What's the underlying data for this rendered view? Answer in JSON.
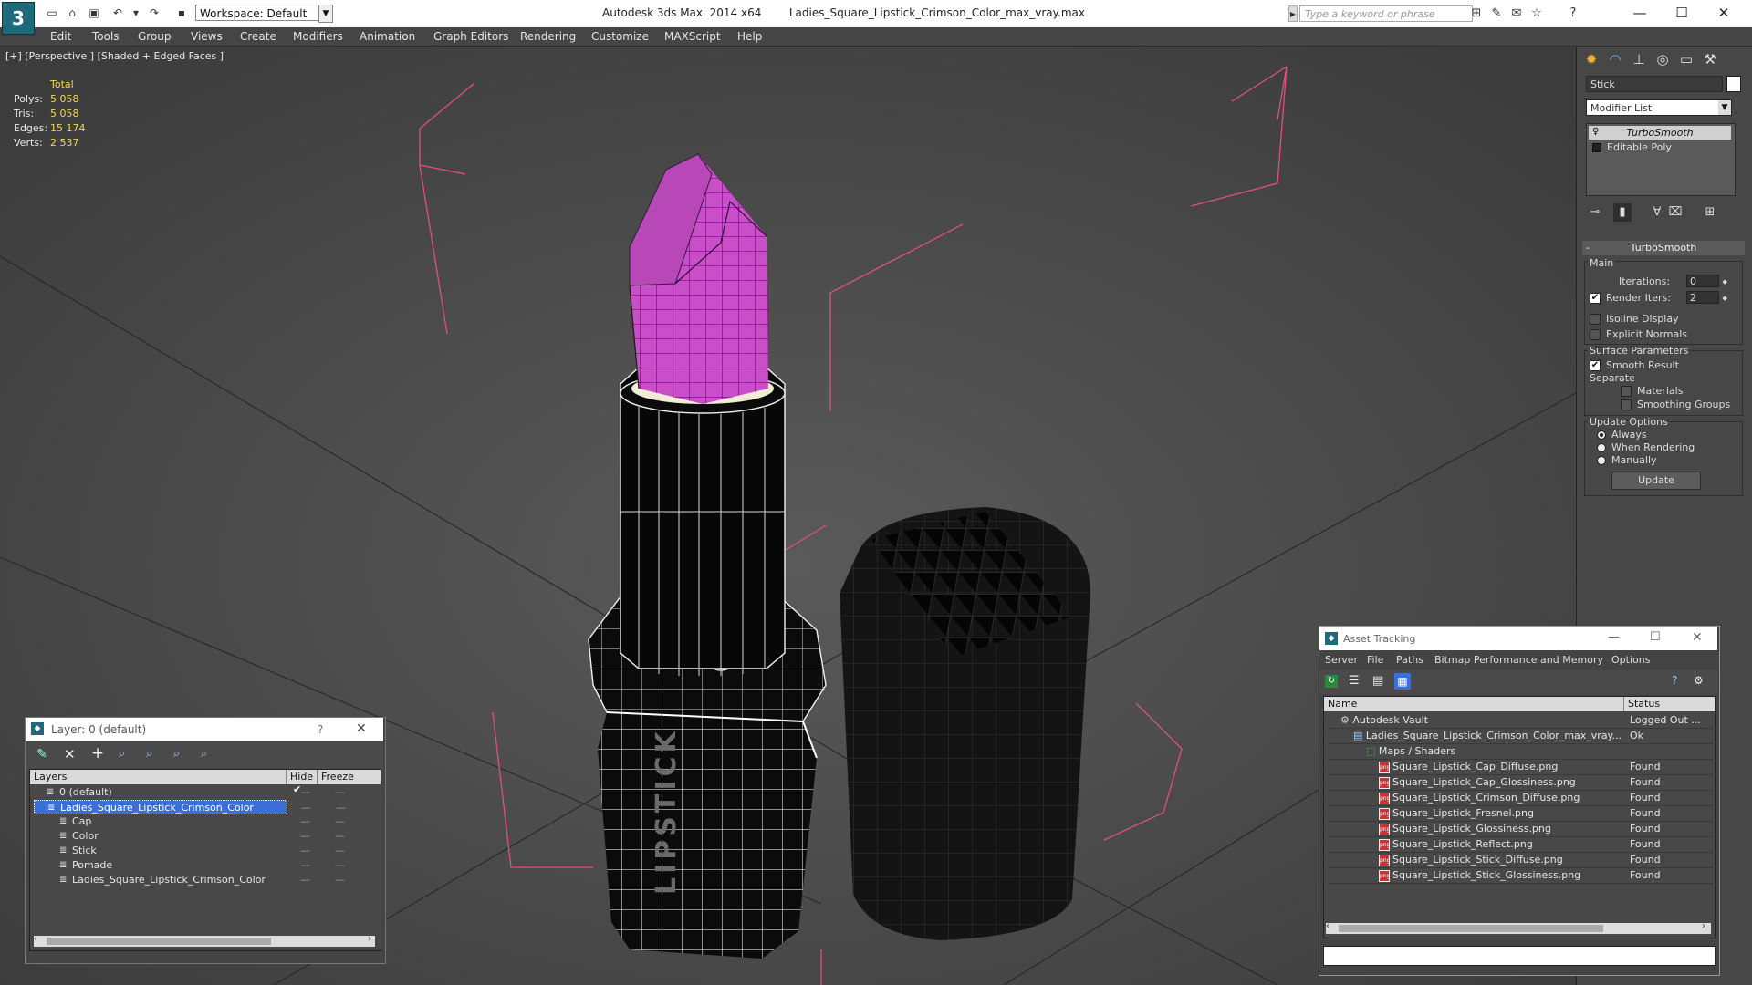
{
  "title_bar": {
    "app": "Autodesk 3ds Max  2014 x64",
    "file": "Ladies_Square_Lipstick_Crimson_Color_max_vray.max",
    "workspace": "Workspace: Default",
    "search_placeholder": "Type a keyword or phrase",
    "logo": "3"
  },
  "menu": [
    "Edit",
    "Tools",
    "Group",
    "Views",
    "Create",
    "Modifiers",
    "Animation",
    "Graph Editors",
    "Rendering",
    "Customize",
    "MAXScript",
    "Help"
  ],
  "viewport": {
    "label": "[+] [Perspective ] [Shaded + Edged Faces ]",
    "stats_header": "Total",
    "stats": [
      {
        "label": "Polys:",
        "value": "5 058"
      },
      {
        "label": "Tris:",
        "value": "5 058"
      },
      {
        "label": "Edges:",
        "value": "15 174"
      },
      {
        "label": "Verts:",
        "value": "2 537"
      }
    ],
    "engraving": "LIPSTICK"
  },
  "command_panel": {
    "object_name": "Stick",
    "modifier_list": "Modifier List",
    "stack": [
      "TurboSmooth",
      "Editable Poly"
    ],
    "rollout_title": "TurboSmooth",
    "main_label": "Main",
    "iterations_label": "Iterations:",
    "iterations_value": "0",
    "render_iters_label": "Render Iters:",
    "render_iters_value": "2",
    "isoline": "Isoline Display",
    "explicit": "Explicit Normals",
    "surface_label": "Surface Parameters",
    "smooth_result": "Smooth Result",
    "separate": "Separate",
    "materials": "Materials",
    "smoothing_groups": "Smoothing Groups",
    "update_options": "Update Options",
    "always": "Always",
    "when_rendering": "When Rendering",
    "manually": "Manually",
    "update_button": "Update"
  },
  "layer_dialog": {
    "title": "Layer: 0 (default)",
    "help": "?",
    "columns": [
      "Layers",
      "Hide",
      "Freeze"
    ],
    "rows": [
      {
        "name": "0 (default)",
        "indent": 1
      },
      {
        "name": "Ladies_Square_Lipstick_Crimson_Color",
        "indent": 1,
        "selected": true
      },
      {
        "name": "Cap",
        "indent": 2
      },
      {
        "name": "Color",
        "indent": 2
      },
      {
        "name": "Stick",
        "indent": 2
      },
      {
        "name": "Pomade",
        "indent": 2
      },
      {
        "name": "Ladies_Square_Lipstick_Crimson_Color",
        "indent": 2
      }
    ]
  },
  "asset_dialog": {
    "title": "Asset Tracking",
    "menu": [
      "Server",
      "File",
      "Paths",
      "Bitmap Performance and Memory",
      "Options"
    ],
    "columns": [
      "Name",
      "Status"
    ],
    "rows": [
      {
        "name": "Autodesk Vault",
        "status": "Logged Out ...",
        "indent": 1
      },
      {
        "name": "Ladies_Square_Lipstick_Crimson_Color_max_vray....",
        "status": "Ok",
        "indent": 2
      },
      {
        "name": "Maps / Shaders",
        "status": "",
        "indent": 3
      },
      {
        "name": "Square_Lipstick_Cap_Diffuse.png",
        "status": "Found",
        "indent": 4
      },
      {
        "name": "Square_Lipstick_Cap_Glossiness.png",
        "status": "Found",
        "indent": 4
      },
      {
        "name": "Square_Lipstick_Crimson_Diffuse.png",
        "status": "Found",
        "indent": 4
      },
      {
        "name": "Square_Lipstick_Fresnel.png",
        "status": "Found",
        "indent": 4
      },
      {
        "name": "Square_Lipstick_Glossiness.png",
        "status": "Found",
        "indent": 4
      },
      {
        "name": "Square_Lipstick_Reflect.png",
        "status": "Found",
        "indent": 4
      },
      {
        "name": "Square_Lipstick_Stick_Diffuse.png",
        "status": "Found",
        "indent": 4
      },
      {
        "name": "Square_Lipstick_Stick_Glossiness.png",
        "status": "Found",
        "indent": 4
      }
    ]
  },
  "colors": {
    "pomade": "#c94fc9",
    "selection_wire": "#e0507a",
    "layer_select": "#3a6fd8"
  }
}
